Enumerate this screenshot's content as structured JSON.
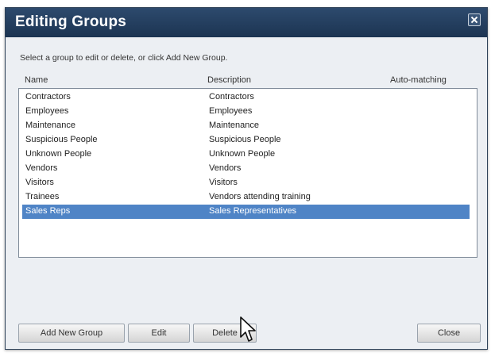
{
  "dialog": {
    "title": "Editing Groups",
    "instruction": "Select a group to edit or delete, or click Add New Group."
  },
  "columns": {
    "name": "Name",
    "description": "Description",
    "auto_matching": "Auto-matching"
  },
  "groups": [
    {
      "name": "Contractors",
      "description": "Contractors"
    },
    {
      "name": "Employees",
      "description": "Employees"
    },
    {
      "name": "Maintenance",
      "description": "Maintenance"
    },
    {
      "name": "Suspicious People",
      "description": "Suspicious People"
    },
    {
      "name": "Unknown People",
      "description": "Unknown People"
    },
    {
      "name": "Vendors",
      "description": "Vendors"
    },
    {
      "name": "Visitors",
      "description": "Visitors"
    },
    {
      "name": "Trainees",
      "description": "Vendors attending training"
    },
    {
      "name": "Sales Reps",
      "description": "Sales Representatives"
    }
  ],
  "selected_group": "Sales Reps",
  "buttons": {
    "add_new_group": "Add New Group",
    "edit": "Edit",
    "delete": "Delete",
    "close": "Close"
  },
  "icons": {
    "close": "close-x-icon",
    "cursor": "mouse-pointer-icon"
  },
  "colors": {
    "titlebar": "#223b5b",
    "selection": "#4f84c6",
    "dialog_background": "#eceff3"
  }
}
